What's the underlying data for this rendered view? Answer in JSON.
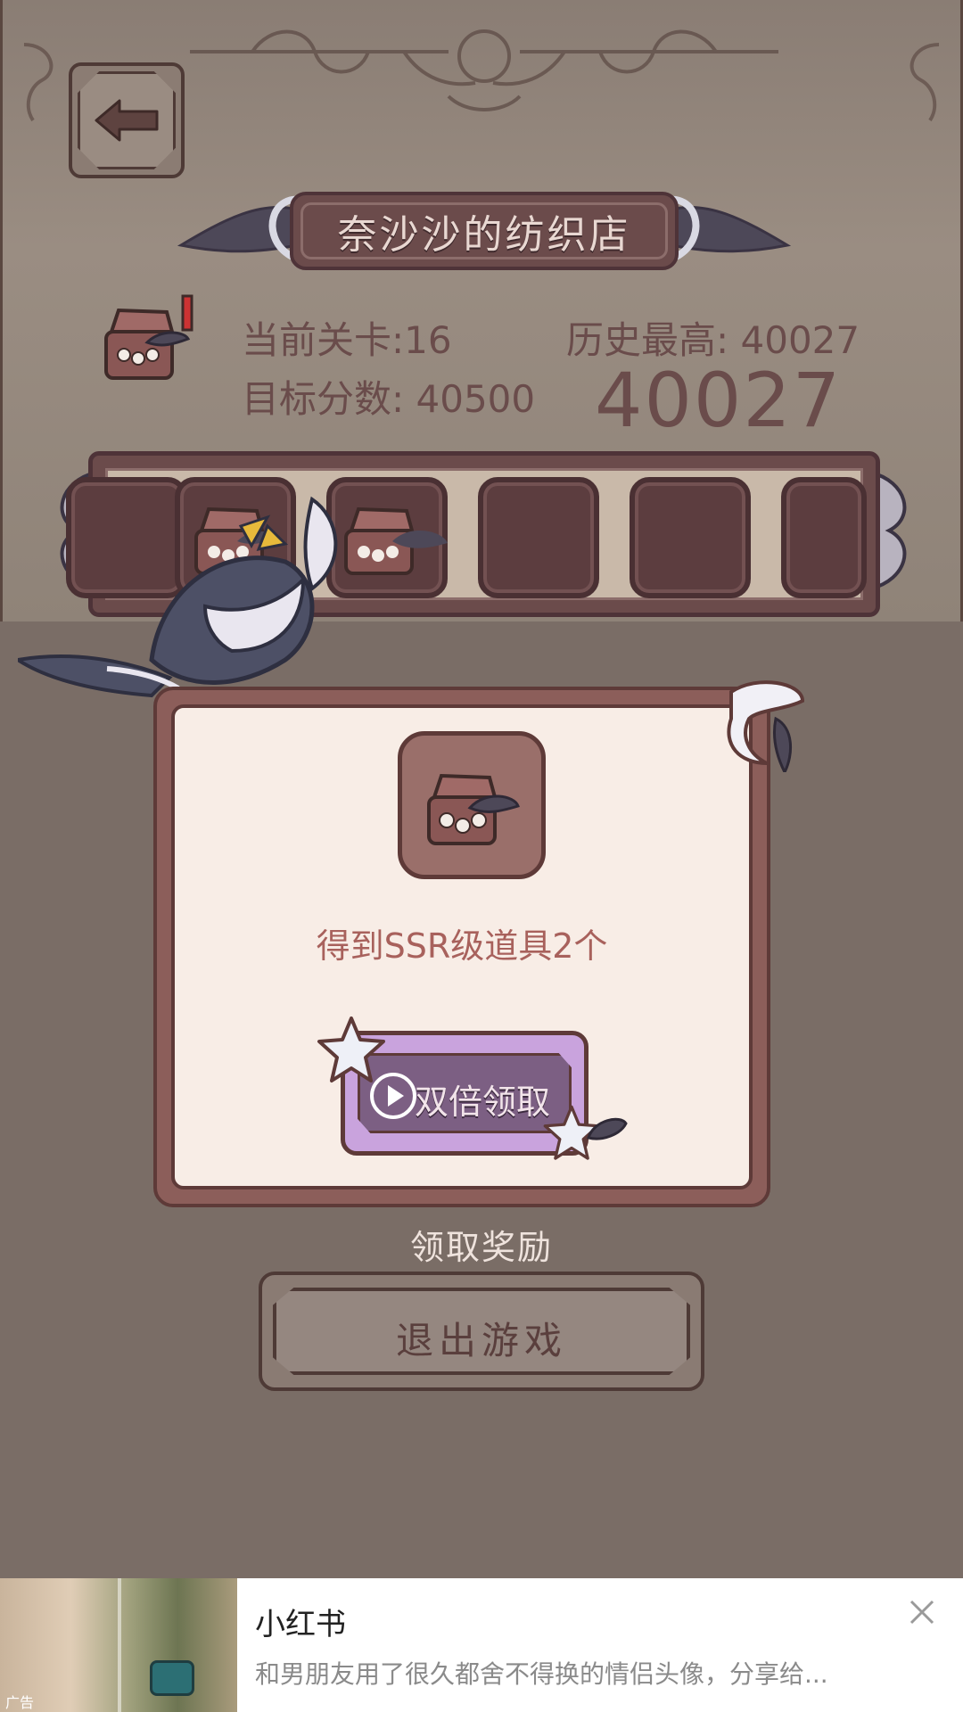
{
  "header": {
    "shop_title": "奈沙沙的纺织店",
    "current_level": "当前关卡:16",
    "history_best": "历史最高: 40027",
    "target_score": "目标分数: 40500",
    "current_score": "40027"
  },
  "slot_bar": {
    "slots": [
      "filled",
      "filled",
      "filled",
      "empty",
      "empty",
      "empty"
    ]
  },
  "dialog": {
    "reward_text": "得到SSR级道具2个",
    "double_claim_label": "双倍领取",
    "item_icon": "jewelry-box-icon"
  },
  "claim_reward_label": "领取奖励",
  "exit_label": "退出游戏",
  "ad": {
    "tag": "广告",
    "title": "小红书",
    "description": "和男朋友用了很久都舍不得换的情侣头像，分享给..."
  },
  "colors": {
    "background": "#7a6d66",
    "panel": "#f8ede6",
    "frame": "#8c5e5a",
    "accent_text": "#a8615c",
    "button_purple": "#c9a3dd"
  }
}
